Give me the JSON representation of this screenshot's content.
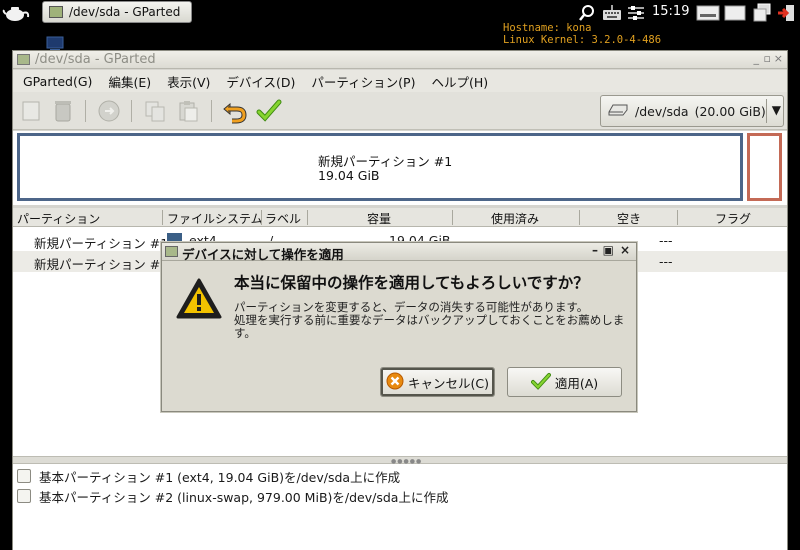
{
  "taskbar": {
    "task_title": "/dev/sda - GParted",
    "clock": "15:19"
  },
  "conky": {
    "line1": "Hostname: kona",
    "line2": "Linux Kernel: 3.2.0-4-486"
  },
  "window": {
    "title": "/dev/sda - GParted"
  },
  "menubar": {
    "items": [
      "GParted(G)",
      "編集(E)",
      "表示(V)",
      "デバイス(D)",
      "パーティション(P)",
      "ヘルプ(H)"
    ]
  },
  "toolbar": {
    "device": "/dev/sda",
    "device_size": "(20.00 GiB)"
  },
  "diskmap": {
    "partition_label": "新規パーティション #1",
    "partition_size": "19.04 GiB"
  },
  "table": {
    "columns": {
      "partition": "パーティション",
      "filesystem": "ファイルシステム",
      "label": "ラベル",
      "size": "容量",
      "used": "使用済み",
      "free": "空き",
      "flags": "フラグ"
    },
    "rows": [
      {
        "partition": "新規パーティション #1",
        "filesystem": "ext4",
        "label": "/",
        "size": "19.04 GiB",
        "used": "---",
        "free": "---",
        "fs_color": "#3b5f86"
      },
      {
        "partition": "新規パーティション #2",
        "used": "---",
        "free": "---"
      }
    ]
  },
  "pending": {
    "ops": [
      "基本パーティション #1 (ext4, 19.04 GiB)を/dev/sda上に作成",
      "基本パーティション #2 (linux-swap, 979.00 MiB)を/dev/sda上に作成"
    ]
  },
  "dialog": {
    "title": "デバイスに対して操作を適用",
    "heading": "本当に保留中の操作を適用してもよろしいですか？",
    "message_line1": "パーティションを変更すると、データの消失する可能性があります。",
    "message_line2": "処理を実行する前に重要なデータはバックアップしておくことをお薦めします。",
    "cancel_label": "キャンセル(C)",
    "apply_label": "適用(A)"
  }
}
